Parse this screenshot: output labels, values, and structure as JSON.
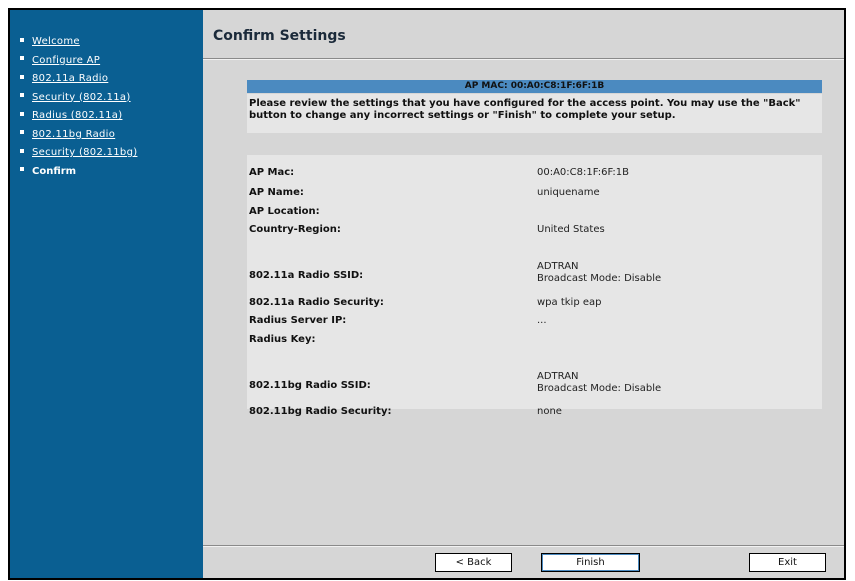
{
  "nav": {
    "items": [
      {
        "label": "Welcome"
      },
      {
        "label": "Configure AP"
      },
      {
        "label": "802.11a Radio"
      },
      {
        "label": "Security (802.11a)"
      },
      {
        "label": "Radius (802.11a)"
      },
      {
        "label": "802.11bg Radio"
      },
      {
        "label": "Security (802.11bg)"
      },
      {
        "label": "Confirm"
      }
    ]
  },
  "page": {
    "title": "Confirm Settings",
    "mac_banner": "AP MAC: 00:A0:C8:1F:6F:1B",
    "instructions": "Please review the settings that you have configured for the access point. You may use the \"Back\" button to change any incorrect settings or \"Finish\" to complete your setup."
  },
  "summary": {
    "ap_mac_label": "AP Mac:",
    "ap_mac_value": "00:A0:C8:1F:6F:1B",
    "ap_name_label": "AP Name:",
    "ap_name_value": "uniquename",
    "ap_location_label": "AP Location:",
    "country_label": "Country-Region:",
    "country_value": "United States",
    "a_ssid_label": "802.11a Radio SSID:",
    "a_ssid_value": "ADTRAN",
    "a_broadcast_value": "Broadcast Mode: Disable",
    "a_security_label": "802.11a Radio Security:",
    "a_security_value": "wpa tkip eap",
    "radius_ip_label": "Radius Server IP:",
    "radius_ip_value": "...",
    "radius_key_label": "Radius Key:",
    "bg_ssid_label": "802.11bg Radio SSID:",
    "bg_ssid_value": "ADTRAN",
    "bg_broadcast_value": "Broadcast Mode: Disable",
    "bg_security_label": "802.11bg Radio Security:",
    "bg_security_value": "none"
  },
  "buttons": {
    "back": "< Back",
    "finish": "Finish",
    "exit": "Exit"
  }
}
